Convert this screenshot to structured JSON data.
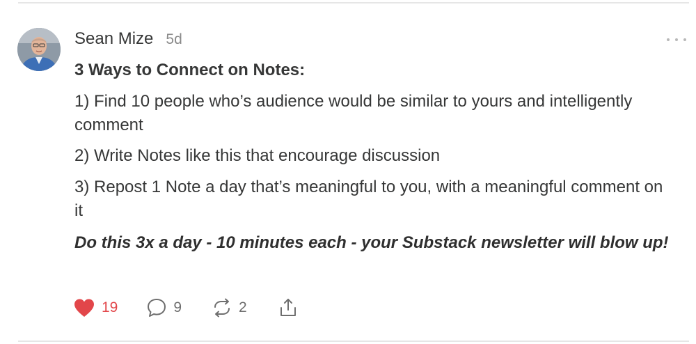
{
  "note": {
    "author": "Sean Mize",
    "timestamp": "5d",
    "heading": "3 Ways to Connect on Notes:",
    "paragraphs": [
      "1) Find 10 people who’s audience would be similar to yours and intelligently comment",
      "2) Write Notes like this that encourage discussion",
      "3) Repost 1 Note a day that’s meaningful to you, with a meaningful comment on it"
    ],
    "emphasis": "Do this 3x a day - 10 minutes each - your Substack newsletter will blow up!"
  },
  "actions": {
    "likes": "19",
    "comments": "9",
    "restacks": "2"
  },
  "icons": {
    "like": "heart-icon",
    "comment": "comment-bubble-icon",
    "restack": "restack-icon",
    "share": "share-icon",
    "more": "more-horizontal-icon"
  },
  "colors": {
    "like_active": "#e2464a",
    "text": "#363737",
    "muted": "#8a8a8a"
  }
}
